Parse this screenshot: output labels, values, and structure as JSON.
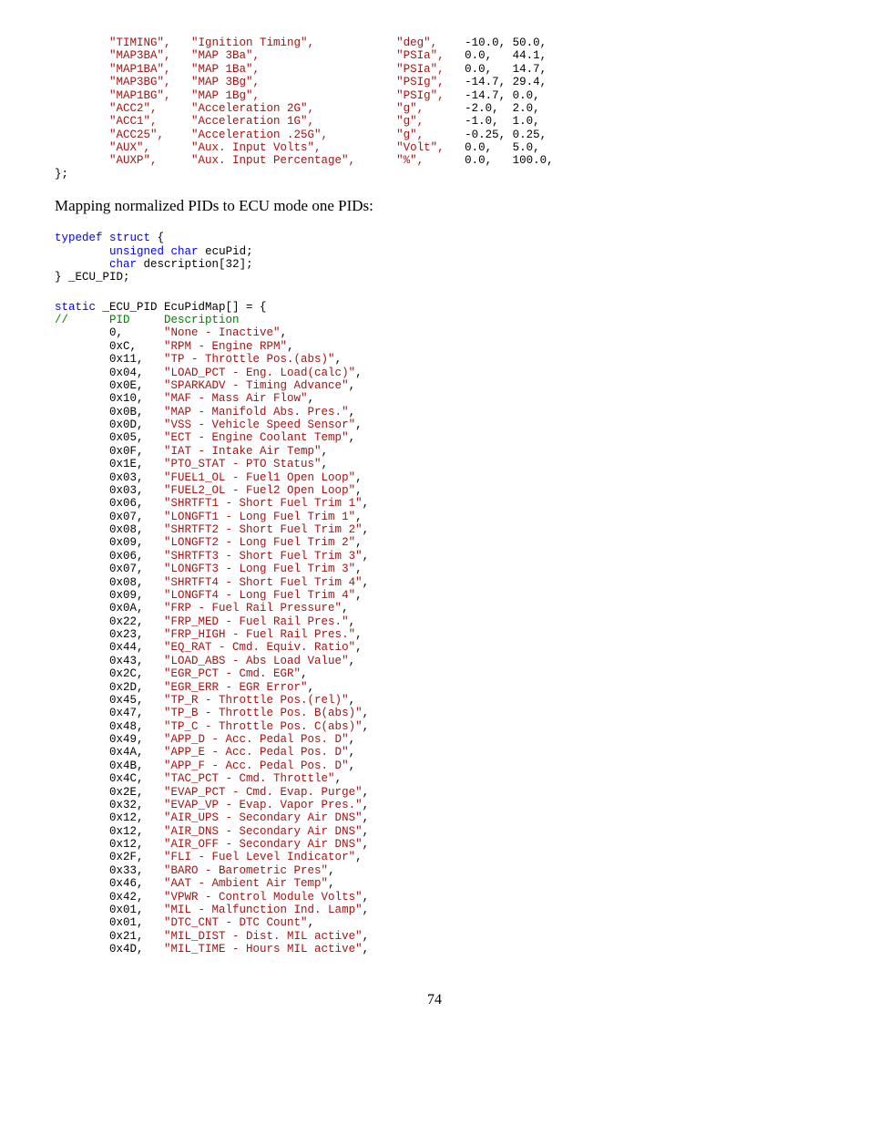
{
  "top_table": {
    "rows": [
      {
        "key": "TIMING",
        "desc": "Ignition Timing",
        "unit": "deg",
        "min": "-10.0",
        "max": "50.0"
      },
      {
        "key": "MAP3BA",
        "desc": "MAP 3Ba",
        "unit": "PSIa",
        "min": "0.0",
        "max": "44.1"
      },
      {
        "key": "MAP1BA",
        "desc": "MAP 1Ba",
        "unit": "PSIa",
        "min": "0.0",
        "max": "14.7"
      },
      {
        "key": "MAP3BG",
        "desc": "MAP 3Bg",
        "unit": "PSIg",
        "min": "-14.7",
        "max": "29.4"
      },
      {
        "key": "MAP1BG",
        "desc": "MAP 1Bg",
        "unit": "PSIg",
        "min": "-14.7",
        "max": "0.0"
      },
      {
        "key": "ACC2",
        "desc": "Acceleration 2G",
        "unit": "g",
        "min": "-2.0",
        "max": "2.0"
      },
      {
        "key": "ACC1",
        "desc": "Acceleration 1G",
        "unit": "g",
        "min": "-1.0",
        "max": "1.0"
      },
      {
        "key": "ACC25",
        "desc": "Acceleration .25G",
        "unit": "g",
        "min": "-0.25",
        "max": "0.25"
      },
      {
        "key": "AUX",
        "desc": "Aux. Input Volts",
        "unit": "Volt",
        "min": "0.0",
        "max": "5.0"
      },
      {
        "key": "AUXP",
        "desc": "Aux. Input Percentage",
        "unit": "%",
        "min": "0.0",
        "max": "100.0"
      }
    ],
    "closer": "};"
  },
  "prose_line": "Mapping normalized PIDs to ECU mode one PIDs:",
  "struct_block": {
    "l1": "typedef struct {",
    "l2": "        unsigned char ecuPid;",
    "l3": "        char description[32];",
    "l4": "} _ECU_PID;"
  },
  "map_header": {
    "decl": "static _ECU_PID EcuPidMap[] = {",
    "comment": "//      PID     Description"
  },
  "ecu_map": [
    {
      "pid": "0,",
      "desc": "None - Inactive"
    },
    {
      "pid": "0xC,",
      "desc": "RPM - Engine RPM"
    },
    {
      "pid": "0x11,",
      "desc": "TP - Throttle Pos.(abs)"
    },
    {
      "pid": "0x04,",
      "desc": "LOAD_PCT - Eng. Load(calc)"
    },
    {
      "pid": "0x0E,",
      "desc": "SPARKADV - Timing Advance"
    },
    {
      "pid": "0x10,",
      "desc": "MAF - Mass Air Flow"
    },
    {
      "pid": "0x0B,",
      "desc": "MAP - Manifold Abs. Pres."
    },
    {
      "pid": "0x0D,",
      "desc": "VSS - Vehicle Speed Sensor"
    },
    {
      "pid": "0x05,",
      "desc": "ECT - Engine Coolant Temp"
    },
    {
      "pid": "0x0F,",
      "desc": "IAT - Intake Air Temp"
    },
    {
      "pid": "0x1E,",
      "desc": "PTO_STAT - PTO Status"
    },
    {
      "pid": "0x03,",
      "desc": "FUEL1_OL - Fuel1 Open Loop"
    },
    {
      "pid": "0x03,",
      "desc": "FUEL2_OL - Fuel2 Open Loop"
    },
    {
      "pid": "0x06,",
      "desc": "SHRTFT1 - Short Fuel Trim 1"
    },
    {
      "pid": "0x07,",
      "desc": "LONGFT1 - Long Fuel Trim 1"
    },
    {
      "pid": "0x08,",
      "desc": "SHRTFT2 - Short Fuel Trim 2"
    },
    {
      "pid": "0x09,",
      "desc": "LONGFT2 - Long Fuel Trim 2"
    },
    {
      "pid": "0x06,",
      "desc": "SHRTFT3 - Short Fuel Trim 3"
    },
    {
      "pid": "0x07,",
      "desc": "LONGFT3 - Long Fuel Trim 3"
    },
    {
      "pid": "0x08,",
      "desc": "SHRTFT4 - Short Fuel Trim 4"
    },
    {
      "pid": "0x09,",
      "desc": "LONGFT4 - Long Fuel Trim 4"
    },
    {
      "pid": "0x0A,",
      "desc": "FRP - Fuel Rail Pressure"
    },
    {
      "pid": "0x22,",
      "desc": "FRP_MED - Fuel Rail Pres."
    },
    {
      "pid": "0x23,",
      "desc": "FRP_HIGH - Fuel Rail Pres."
    },
    {
      "pid": "0x44,",
      "desc": "EQ_RAT - Cmd. Equiv. Ratio"
    },
    {
      "pid": "0x43,",
      "desc": "LOAD_ABS - Abs Load Value"
    },
    {
      "pid": "0x2C,",
      "desc": "EGR_PCT - Cmd. EGR"
    },
    {
      "pid": "0x2D,",
      "desc": "EGR_ERR - EGR Error"
    },
    {
      "pid": "0x45,",
      "desc": "TP_R - Throttle Pos.(rel)"
    },
    {
      "pid": "0x47,",
      "desc": "TP_B - Throttle Pos. B(abs)"
    },
    {
      "pid": "0x48,",
      "desc": "TP_C - Throttle Pos. C(abs)"
    },
    {
      "pid": "0x49,",
      "desc": "APP_D - Acc. Pedal Pos. D"
    },
    {
      "pid": "0x4A,",
      "desc": "APP_E - Acc. Pedal Pos. D"
    },
    {
      "pid": "0x4B,",
      "desc": "APP_F - Acc. Pedal Pos. D"
    },
    {
      "pid": "0x4C,",
      "desc": "TAC_PCT - Cmd. Throttle"
    },
    {
      "pid": "0x2E,",
      "desc": "EVAP_PCT - Cmd. Evap. Purge"
    },
    {
      "pid": "0x32,",
      "desc": "EVAP_VP - Evap. Vapor Pres."
    },
    {
      "pid": "0x12,",
      "desc": "AIR_UPS - Secondary Air DNS"
    },
    {
      "pid": "0x12,",
      "desc": "AIR_DNS - Secondary Air DNS"
    },
    {
      "pid": "0x12,",
      "desc": "AIR_OFF - Secondary Air DNS"
    },
    {
      "pid": "0x2F,",
      "desc": "FLI - Fuel Level Indicator"
    },
    {
      "pid": "0x33,",
      "desc": "BARO - Barometric Pres"
    },
    {
      "pid": "0x46,",
      "desc": "AAT - Ambient Air Temp"
    },
    {
      "pid": "0x42,",
      "desc": "VPWR - Control Module Volts"
    },
    {
      "pid": "0x01,",
      "desc": "MIL - Malfunction Ind. Lamp"
    },
    {
      "pid": "0x01,",
      "desc": "DTC_CNT - DTC Count"
    },
    {
      "pid": "0x21,",
      "desc": "MIL_DIST - Dist. MIL active"
    },
    {
      "pid": "0x4D,",
      "desc": "MIL_TIME - Hours MIL active"
    }
  ],
  "page_number": "74"
}
